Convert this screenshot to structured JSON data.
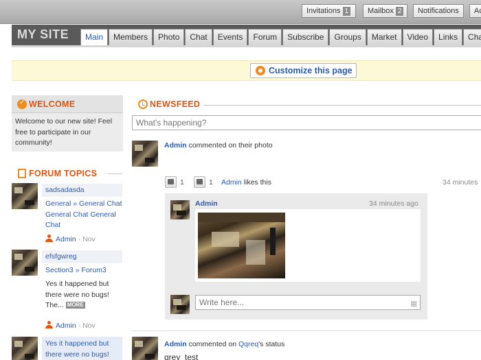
{
  "topbar": {
    "invitations": {
      "label": "Invitations",
      "count": "1"
    },
    "mailbox": {
      "label": "Mailbox",
      "count": "2"
    },
    "notifications": {
      "label": "Notifications"
    },
    "cut_button": {
      "label": "Ac"
    }
  },
  "site": {
    "title": "MY SITE"
  },
  "tabs": [
    "Main",
    "Members",
    "Photo",
    "Chat",
    "Events",
    "Forum",
    "Subscribe",
    "Groups",
    "Market",
    "Video",
    "Links",
    "Chat"
  ],
  "customize": {
    "label": "Customize this page"
  },
  "welcome": {
    "title": "WELCOME",
    "text": "Welcome to our new site! Feel free to participate in our community!"
  },
  "forum": {
    "title": "FORUM TOPICS",
    "topics": [
      {
        "name": "sadsadasda",
        "text": "General » General Chat General Chat General Chat",
        "author": "Admin",
        "date": "· Nov"
      },
      {
        "name": "efsfgwreg",
        "text1": "Section3 » Forum3",
        "text2": "Yes it happened but there were no bugs! The...",
        "more": "MORE",
        "author": "Admin",
        "date": "· Nov"
      },
      {
        "text": "Yes it happened but there were no bugs!"
      }
    ]
  },
  "newsfeed": {
    "title": "NEWSFEED",
    "status_placeholder": "What's happening?",
    "posts": [
      {
        "author": "Admin",
        "action": "commented on their photo",
        "comment_count": "1",
        "like_count": "1",
        "liker": "Admin",
        "likes_text": "likes this",
        "time": "34 minutes",
        "comment": {
          "author": "Admin",
          "time": "34 minutes ago"
        },
        "reply_placeholder": "Write here..."
      },
      {
        "author": "Admin",
        "action": "commented on",
        "target": "Qqreq",
        "suffix": "'s status",
        "body": "grey_test"
      }
    ]
  }
}
